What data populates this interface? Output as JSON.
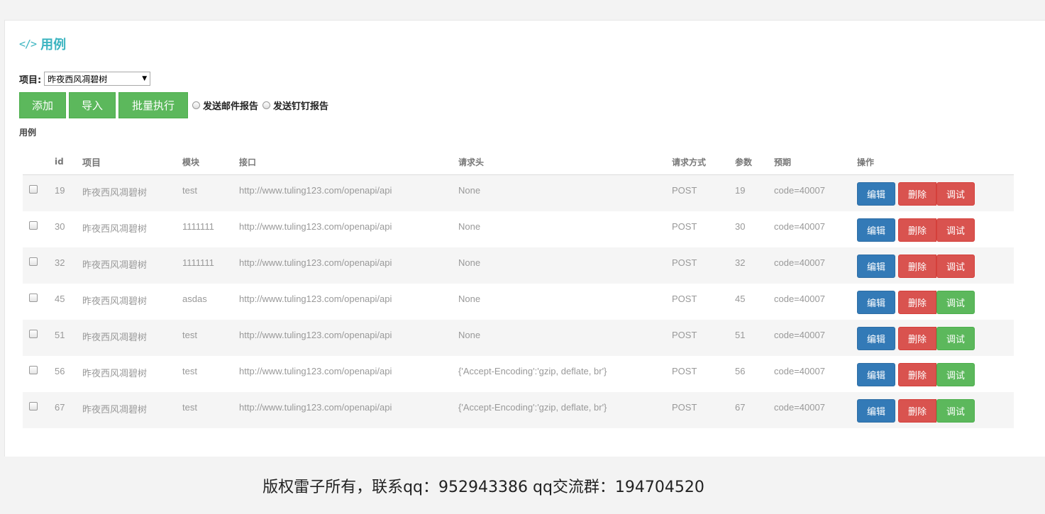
{
  "page": {
    "title": "用例",
    "title_icon": "code-icon",
    "accent_color": "#3bb4c0"
  },
  "project_filter": {
    "label": "项目:",
    "selected": "昨夜西风凋碧树"
  },
  "toolbar": {
    "add_label": "添加",
    "import_label": "导入",
    "batch_label": "批量执行",
    "email_report_label": "发送邮件报告",
    "dingtalk_report_label": "发送钉钉报告"
  },
  "section_label": "用例",
  "table": {
    "columns": [
      "id",
      "项目",
      "模块",
      "接口",
      "请求头",
      "请求方式",
      "参数",
      "预期",
      "操作"
    ],
    "actions": {
      "edit": "编辑",
      "delete": "删除",
      "debug": "调试"
    },
    "rows": [
      {
        "id": "19",
        "project": "昨夜西风凋碧树",
        "module": "test",
        "api": "http://www.tuling123.com/openapi/api",
        "headers": "None",
        "method": "POST",
        "params": "19",
        "expected": "code=40007",
        "debug_style": "red"
      },
      {
        "id": "30",
        "project": "昨夜西风凋碧树",
        "module": "1111111",
        "api": "http://www.tuling123.com/openapi/api",
        "headers": "None",
        "method": "POST",
        "params": "30",
        "expected": "code=40007",
        "debug_style": "red"
      },
      {
        "id": "32",
        "project": "昨夜西风凋碧树",
        "module": "1111111",
        "api": "http://www.tuling123.com/openapi/api",
        "headers": "None",
        "method": "POST",
        "params": "32",
        "expected": "code=40007",
        "debug_style": "red"
      },
      {
        "id": "45",
        "project": "昨夜西风凋碧树",
        "module": "asdas",
        "api": "http://www.tuling123.com/openapi/api",
        "headers": "None",
        "method": "POST",
        "params": "45",
        "expected": "code=40007",
        "debug_style": "green"
      },
      {
        "id": "51",
        "project": "昨夜西风凋碧树",
        "module": "test",
        "api": "http://www.tuling123.com/openapi/api",
        "headers": "None",
        "method": "POST",
        "params": "51",
        "expected": "code=40007",
        "debug_style": "green"
      },
      {
        "id": "56",
        "project": "昨夜西风凋碧树",
        "module": "test",
        "api": "http://www.tuling123.com/openapi/api",
        "headers": "{'Accept-Encoding':'gzip, deflate, br'}",
        "method": "POST",
        "params": "56",
        "expected": "code=40007",
        "debug_style": "green"
      },
      {
        "id": "67",
        "project": "昨夜西风凋碧树",
        "module": "test",
        "api": "http://www.tuling123.com/openapi/api",
        "headers": "{'Accept-Encoding':'gzip, deflate, br'}",
        "method": "POST",
        "params": "67",
        "expected": "code=40007",
        "debug_style": "green"
      }
    ]
  },
  "colors": {
    "green": "#5cb85c",
    "blue": "#337ab7",
    "red": "#d9534f"
  },
  "footer": {
    "text": "版权雷子所有，联系qq：952943386 qq交流群：194704520"
  }
}
